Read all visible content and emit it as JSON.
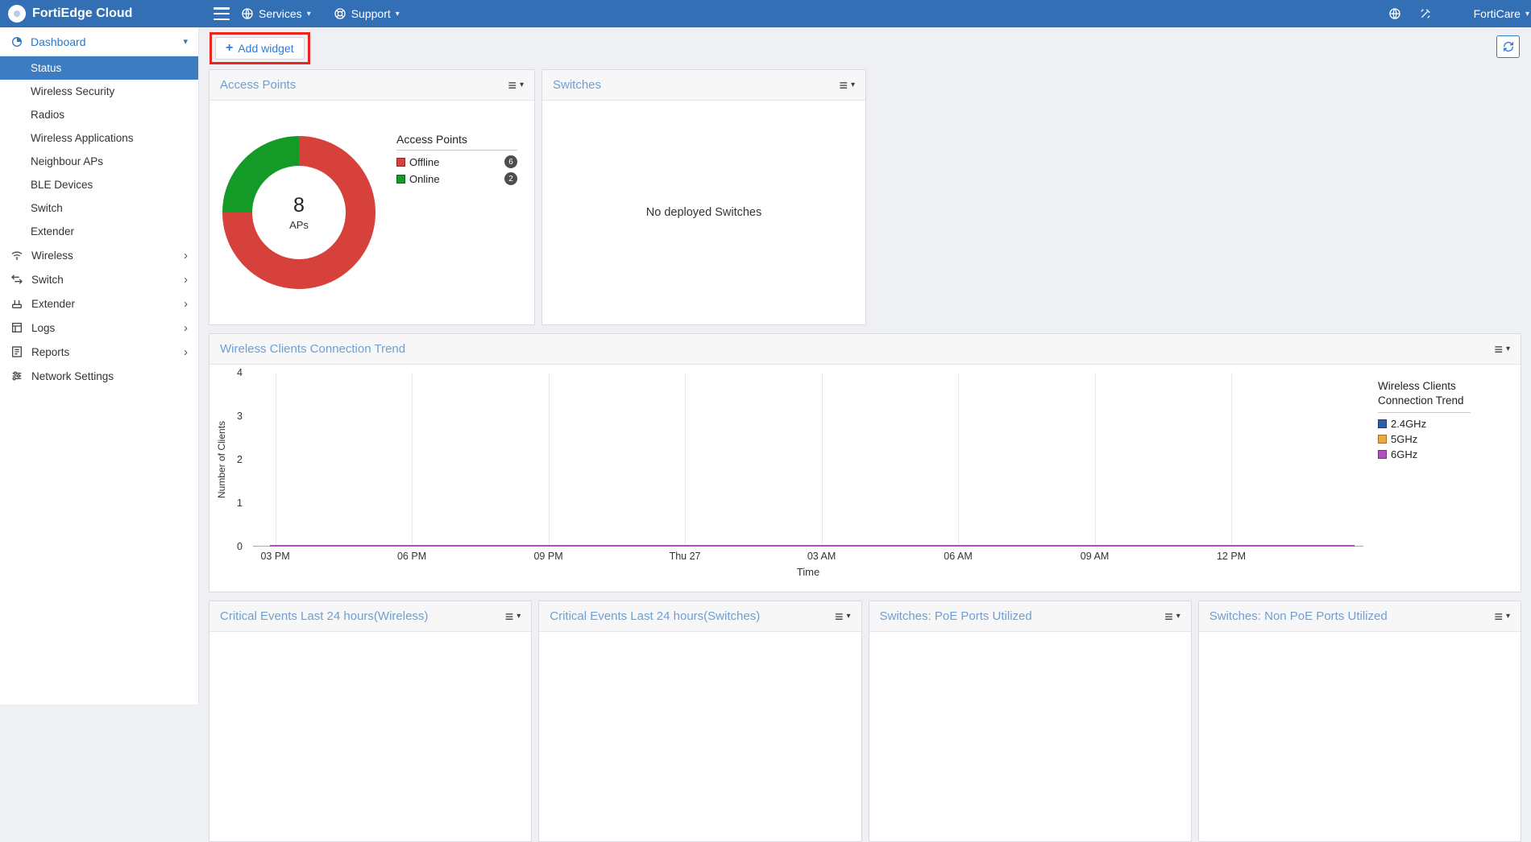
{
  "navbar": {
    "brand": "FortiEdge Cloud",
    "services_label": "Services",
    "support_label": "Support",
    "forticare_label": "FortiCare"
  },
  "icons": {
    "plus": "+",
    "caret_down": "▾",
    "chevron_right": "›",
    "menu_lines": "≡"
  },
  "sidebar": {
    "dashboard_label": "Dashboard",
    "dashboard_items": [
      {
        "label": "Status"
      },
      {
        "label": "Wireless Security"
      },
      {
        "label": "Radios"
      },
      {
        "label": "Wireless Applications"
      },
      {
        "label": "Neighbour APs"
      },
      {
        "label": "BLE Devices"
      },
      {
        "label": "Switch"
      },
      {
        "label": "Extender"
      }
    ],
    "sections": [
      {
        "label": "Wireless"
      },
      {
        "label": "Switch"
      },
      {
        "label": "Extender"
      },
      {
        "label": "Logs"
      },
      {
        "label": "Reports"
      },
      {
        "label": "Network Settings"
      }
    ]
  },
  "toolbar": {
    "add_widget_label": "Add widget"
  },
  "widgets": {
    "access_points": {
      "title": "Access Points"
    },
    "switches": {
      "title": "Switches",
      "empty_text": "No deployed Switches"
    },
    "trend": {
      "title": "Wireless Clients Connection Trend"
    },
    "bottom": [
      {
        "title": "Critical Events Last 24 hours(Wireless)"
      },
      {
        "title": "Critical Events Last 24 hours(Switches)"
      },
      {
        "title": "Switches: PoE Ports Utilized"
      },
      {
        "title": "Switches: Non PoE Ports Utilized"
      }
    ]
  },
  "chart_data": [
    {
      "type": "pie",
      "title": "Access Points",
      "legend_title": "Access Points",
      "labels": [
        "Offline",
        "Online"
      ],
      "values": [
        6,
        2
      ],
      "colors": [
        "#d6413c",
        "#149b27"
      ],
      "donut": true,
      "center_value": "8",
      "center_label": "APs",
      "start_angle": "top",
      "direction": "clockwise"
    },
    {
      "type": "line",
      "title": "Wireless Clients Connection Trend",
      "x": [
        "03 PM",
        "06 PM",
        "09 PM",
        "Thu 27",
        "03 AM",
        "06 AM",
        "09 AM",
        "12 PM"
      ],
      "series": [
        {
          "name": "2.4GHz",
          "color": "#2c5fa8",
          "values": [
            0,
            0,
            0,
            0,
            0,
            0,
            0,
            0
          ]
        },
        {
          "name": "5GHz",
          "color": "#f0a73c",
          "values": [
            0,
            0,
            0,
            0,
            0,
            0,
            0,
            0
          ]
        },
        {
          "name": "6GHz",
          "color": "#b14fc0",
          "values": [
            0,
            0,
            0,
            0,
            0,
            0,
            0,
            0
          ]
        }
      ],
      "xlabel": "Time",
      "ylabel": "Number of Clients",
      "ylim": [
        0,
        4
      ],
      "yticks": [
        0,
        1,
        2,
        3,
        4
      ],
      "grid": "vertical",
      "legend_position": "right"
    }
  ],
  "colors": {
    "navbar_bg": "#336fb4",
    "selected_item_bg": "#3d7cc0",
    "widget_title": "#6d9fd4",
    "accent_blue": "#2d7dd2",
    "annotation_red": "#e8261f"
  }
}
